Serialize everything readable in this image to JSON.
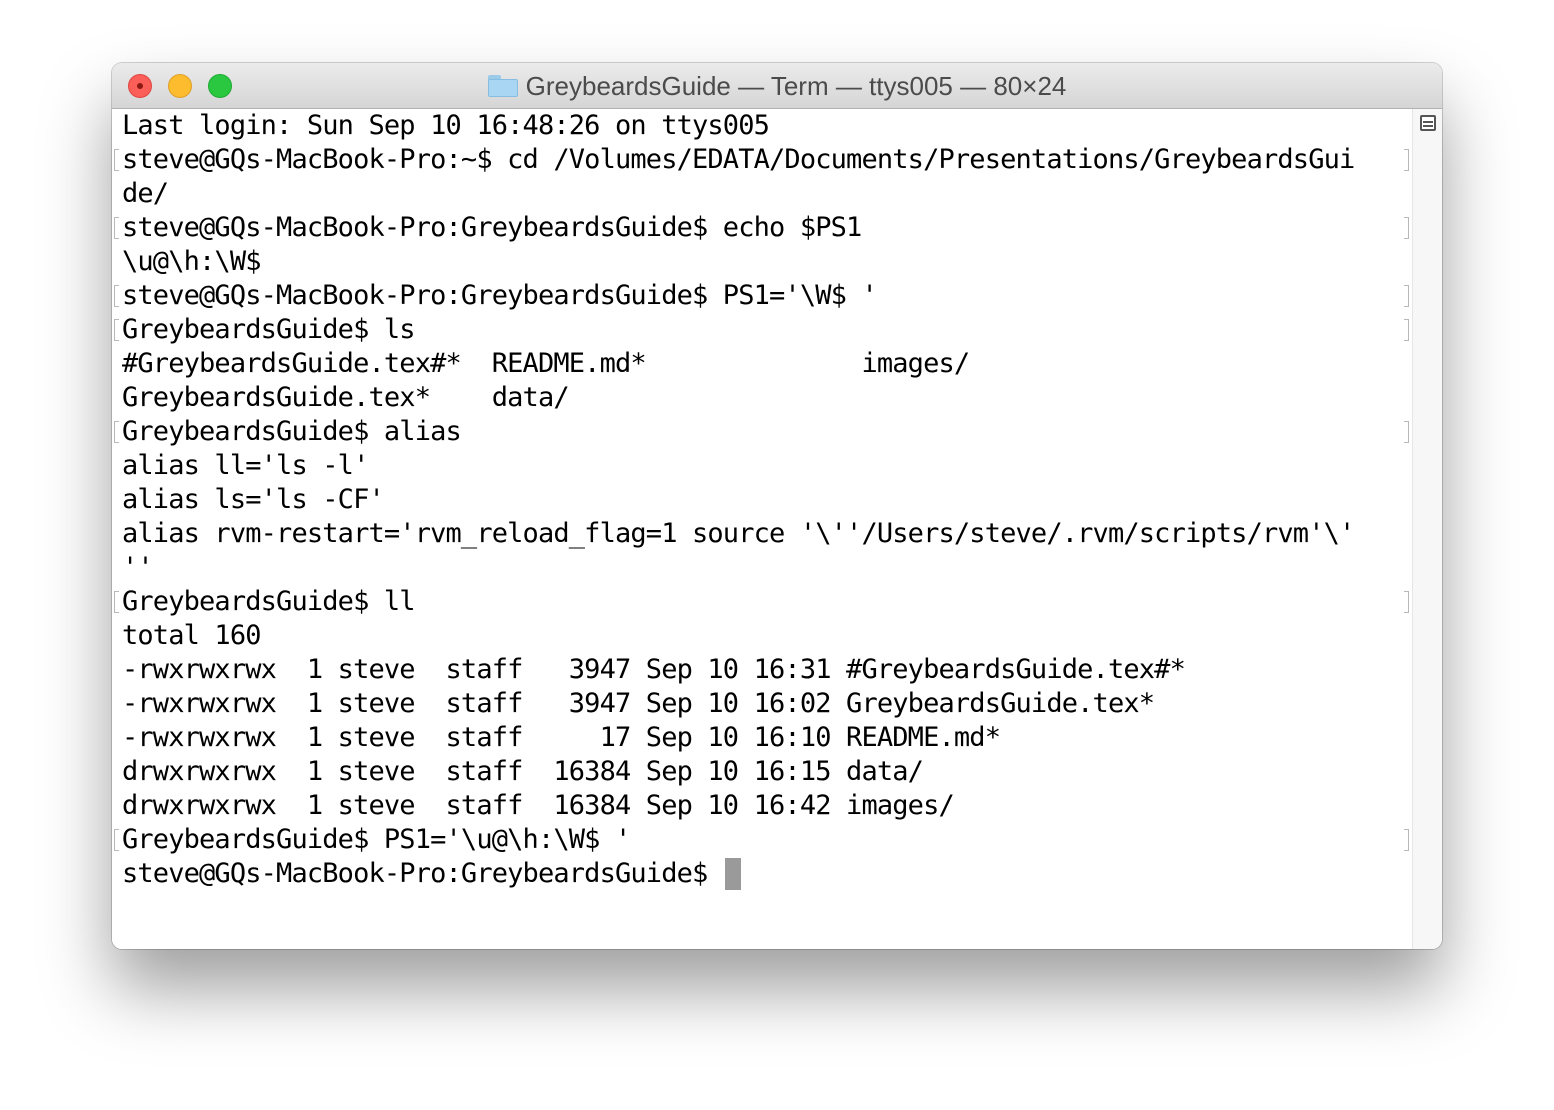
{
  "window": {
    "title": "GreybeardsGuide — Term — ttys005 — 80×24"
  },
  "terminal": {
    "lines": [
      {
        "text": "Last login: Sun Sep 10 16:48:26 on ttys005",
        "marked": false
      },
      {
        "text": "steve@GQs-MacBook-Pro:~$ cd /Volumes/EDATA/Documents/Presentations/GreybeardsGui",
        "marked": true
      },
      {
        "text": "de/",
        "marked": false
      },
      {
        "text": "steve@GQs-MacBook-Pro:GreybeardsGuide$ echo $PS1",
        "marked": true
      },
      {
        "text": "\\u@\\h:\\W$",
        "marked": false
      },
      {
        "text": "steve@GQs-MacBook-Pro:GreybeardsGuide$ PS1='\\W$ '",
        "marked": true
      },
      {
        "text": "GreybeardsGuide$ ls",
        "marked": true
      },
      {
        "text": "#GreybeardsGuide.tex#*  README.md*              images/",
        "marked": false
      },
      {
        "text": "GreybeardsGuide.tex*    data/",
        "marked": false
      },
      {
        "text": "GreybeardsGuide$ alias",
        "marked": true
      },
      {
        "text": "alias ll='ls -l'",
        "marked": false
      },
      {
        "text": "alias ls='ls -CF'",
        "marked": false
      },
      {
        "text": "alias rvm-restart='rvm_reload_flag=1 source '\\''/Users/steve/.rvm/scripts/rvm'\\'",
        "marked": false
      },
      {
        "text": "''",
        "marked": false
      },
      {
        "text": "GreybeardsGuide$ ll",
        "marked": true
      },
      {
        "text": "total 160",
        "marked": false
      },
      {
        "text": "-rwxrwxrwx  1 steve  staff   3947 Sep 10 16:31 #GreybeardsGuide.tex#*",
        "marked": false
      },
      {
        "text": "-rwxrwxrwx  1 steve  staff   3947 Sep 10 16:02 GreybeardsGuide.tex*",
        "marked": false
      },
      {
        "text": "-rwxrwxrwx  1 steve  staff     17 Sep 10 16:10 README.md*",
        "marked": false
      },
      {
        "text": "drwxrwxrwx  1 steve  staff  16384 Sep 10 16:15 data/",
        "marked": false
      },
      {
        "text": "drwxrwxrwx  1 steve  staff  16384 Sep 10 16:42 images/",
        "marked": false
      },
      {
        "text": "GreybeardsGuide$ PS1='\\u@\\h:\\W$ '",
        "marked": true
      },
      {
        "text": "steve@GQs-MacBook-Pro:GreybeardsGuide$ ",
        "marked": false
      }
    ]
  },
  "icons": {
    "folder": "folder-icon",
    "split_view": "split-pane-icon"
  },
  "colors": {
    "close": "#fc5f57",
    "minimize": "#fdbc2e",
    "maximize": "#2ac840",
    "cursor": "#9a9a9a",
    "text": "#000000",
    "background": "#ffffff"
  }
}
